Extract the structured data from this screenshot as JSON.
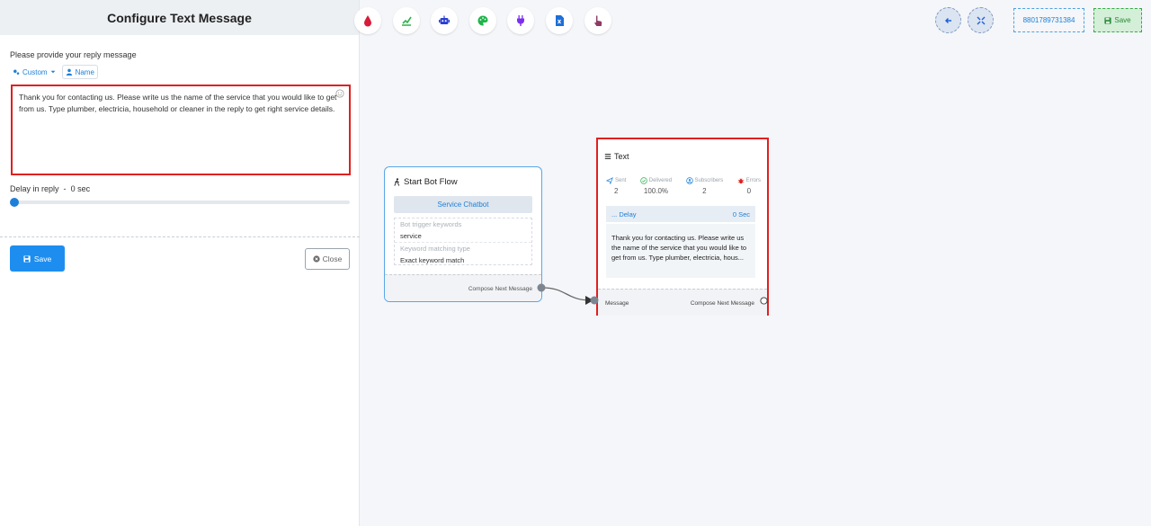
{
  "panel": {
    "title": "Configure Text Message",
    "prompt": "Please provide your reply message",
    "chip_custom": "Custom",
    "chip_name": "Name",
    "reply_text": "Thank you for contacting us. Please write us the name of the service that you would like to get from us. Type plumber, electricia, household or cleaner in the reply to get right service details.",
    "delay_label": "Delay in reply",
    "delay_separator": "-",
    "delay_value": "0 sec",
    "delay_fraction": 0,
    "save_label": "Save",
    "close_label": "Close"
  },
  "toolbar": {
    "tools": [
      {
        "name": "drop-icon",
        "color": "#d81b3a"
      },
      {
        "name": "chart-icon",
        "color": "#2bb24c"
      },
      {
        "name": "robot-icon",
        "color": "#2a3fd1"
      },
      {
        "name": "palette-icon",
        "color": "#20b34a"
      },
      {
        "name": "plug-icon",
        "color": "#7b2ff0"
      },
      {
        "name": "file-icon",
        "color": "#1d6fd8"
      },
      {
        "name": "pointer-icon",
        "color": "#8e3a63"
      }
    ],
    "phone": "8801789731384",
    "save_label": "Save"
  },
  "start_node": {
    "title": "Start Bot Flow",
    "service_button": "Service Chatbot",
    "keywords_label": "Bot trigger keywords",
    "keywords_value": "service",
    "match_label": "Keyword matching type",
    "match_value": "Exact keyword match",
    "compose": "Compose Next Message"
  },
  "text_node": {
    "title": "Text",
    "stats": [
      {
        "label": "Sent",
        "value": "2",
        "icon": "send-icon",
        "color": "#1d7fd8"
      },
      {
        "label": "Delivered",
        "value": "100.0%",
        "icon": "check-circle-icon",
        "color": "#2bb24c"
      },
      {
        "label": "Subscribers",
        "value": "2",
        "icon": "user-circle-icon",
        "color": "#1d7fd8"
      },
      {
        "label": "Errors",
        "value": "0",
        "icon": "bug-icon",
        "color": "#e02020"
      }
    ],
    "delay_label": "... Delay",
    "delay_value": "0 Sec",
    "preview": "Thank you for contacting us. Please write us the name of the service that you would like to get from us. Type plumber, electricia, hous...",
    "message_port": "Message",
    "compose": "Compose Next Message"
  },
  "colors": {
    "accent": "#1d8ef0",
    "highlight": "#e02020",
    "success": "#2bb24c"
  }
}
